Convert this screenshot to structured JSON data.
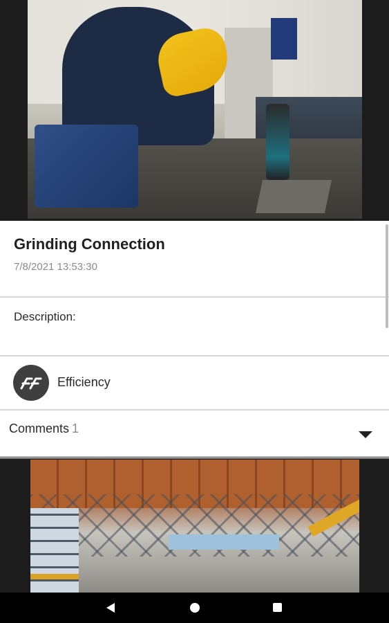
{
  "post": {
    "title": "Grinding Connection",
    "date": "7/8/2021 13:53:30",
    "description_label": "Description:",
    "category": {
      "label": "Efficiency",
      "icon": "ff-logo-icon"
    },
    "comments": {
      "label": "Comments",
      "count": "1",
      "toggle_icon": "caret-down-icon"
    },
    "photo_subject": "workshop-welding-photo"
  },
  "next_post": {
    "photo_subject": "factory-hall-photo"
  },
  "navbar": {
    "back_icon": "back-triangle-icon",
    "home_icon": "home-circle-icon",
    "recents_icon": "recents-square-icon"
  },
  "colors": {
    "card_background": "#ffffff",
    "page_background": "#1c1c1c",
    "title_text": "#202020",
    "secondary_text": "#8a8a8a",
    "divider": "#d8d8d8",
    "logo_background": "#3f3f3f",
    "navbar": "#000000"
  }
}
